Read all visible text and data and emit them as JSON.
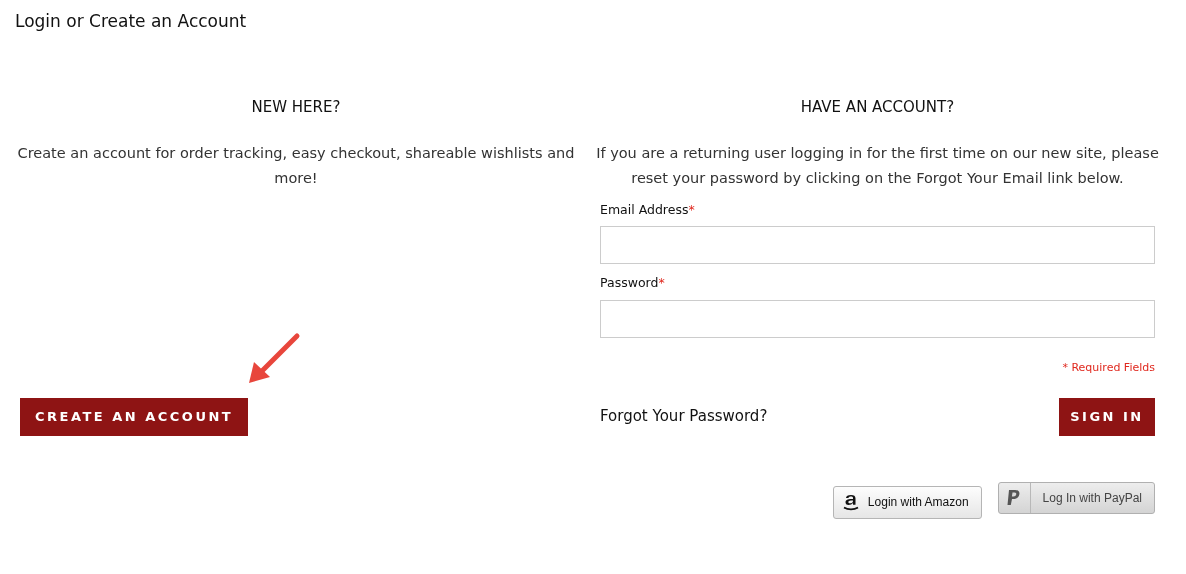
{
  "page_title": "Login or Create an Account",
  "new_customer": {
    "heading": "NEW HERE?",
    "text": "Create an account for order tracking, easy checkout, shareable wishlists and more!",
    "button": "CREATE AN ACCOUNT"
  },
  "login": {
    "heading": "HAVE AN ACCOUNT?",
    "text": "If you are a returning user logging in for the first time on our new site, please reset your password by clicking on the Forgot Your Email link below.",
    "fields": [
      {
        "label": "Email Address",
        "required_mark": "*"
      },
      {
        "label": "Password",
        "required_mark": "*"
      }
    ],
    "required_note": "* Required Fields",
    "forgot_link": "Forgot Your Password?",
    "button": "SIGN IN"
  },
  "social_buttons": [
    {
      "kind": "amazon",
      "label": "Login with Amazon"
    },
    {
      "kind": "paypal",
      "label": "Log In with PayPal"
    }
  ]
}
